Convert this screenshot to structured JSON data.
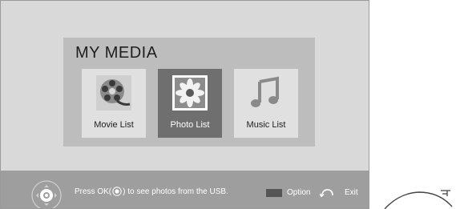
{
  "media": {
    "title": "MY MEDIA",
    "tiles": [
      {
        "label": "Movie List",
        "icon": "film-reel-icon",
        "selected": false
      },
      {
        "label": "Photo List",
        "icon": "flower-photo-icon",
        "selected": true
      },
      {
        "label": "Music List",
        "icon": "music-note-icon",
        "selected": false
      }
    ]
  },
  "footer": {
    "hint_before": "Press OK(",
    "hint_after": ") to see photos from the USB.",
    "option_label": "Option",
    "exit_label": "Exit"
  },
  "colors": {
    "screen_bg": "#d9d9d9",
    "panel_bg": "#bdbdbd",
    "selected_tile": "#6f6f6f",
    "bottom_bar": "#9e9e9e"
  }
}
